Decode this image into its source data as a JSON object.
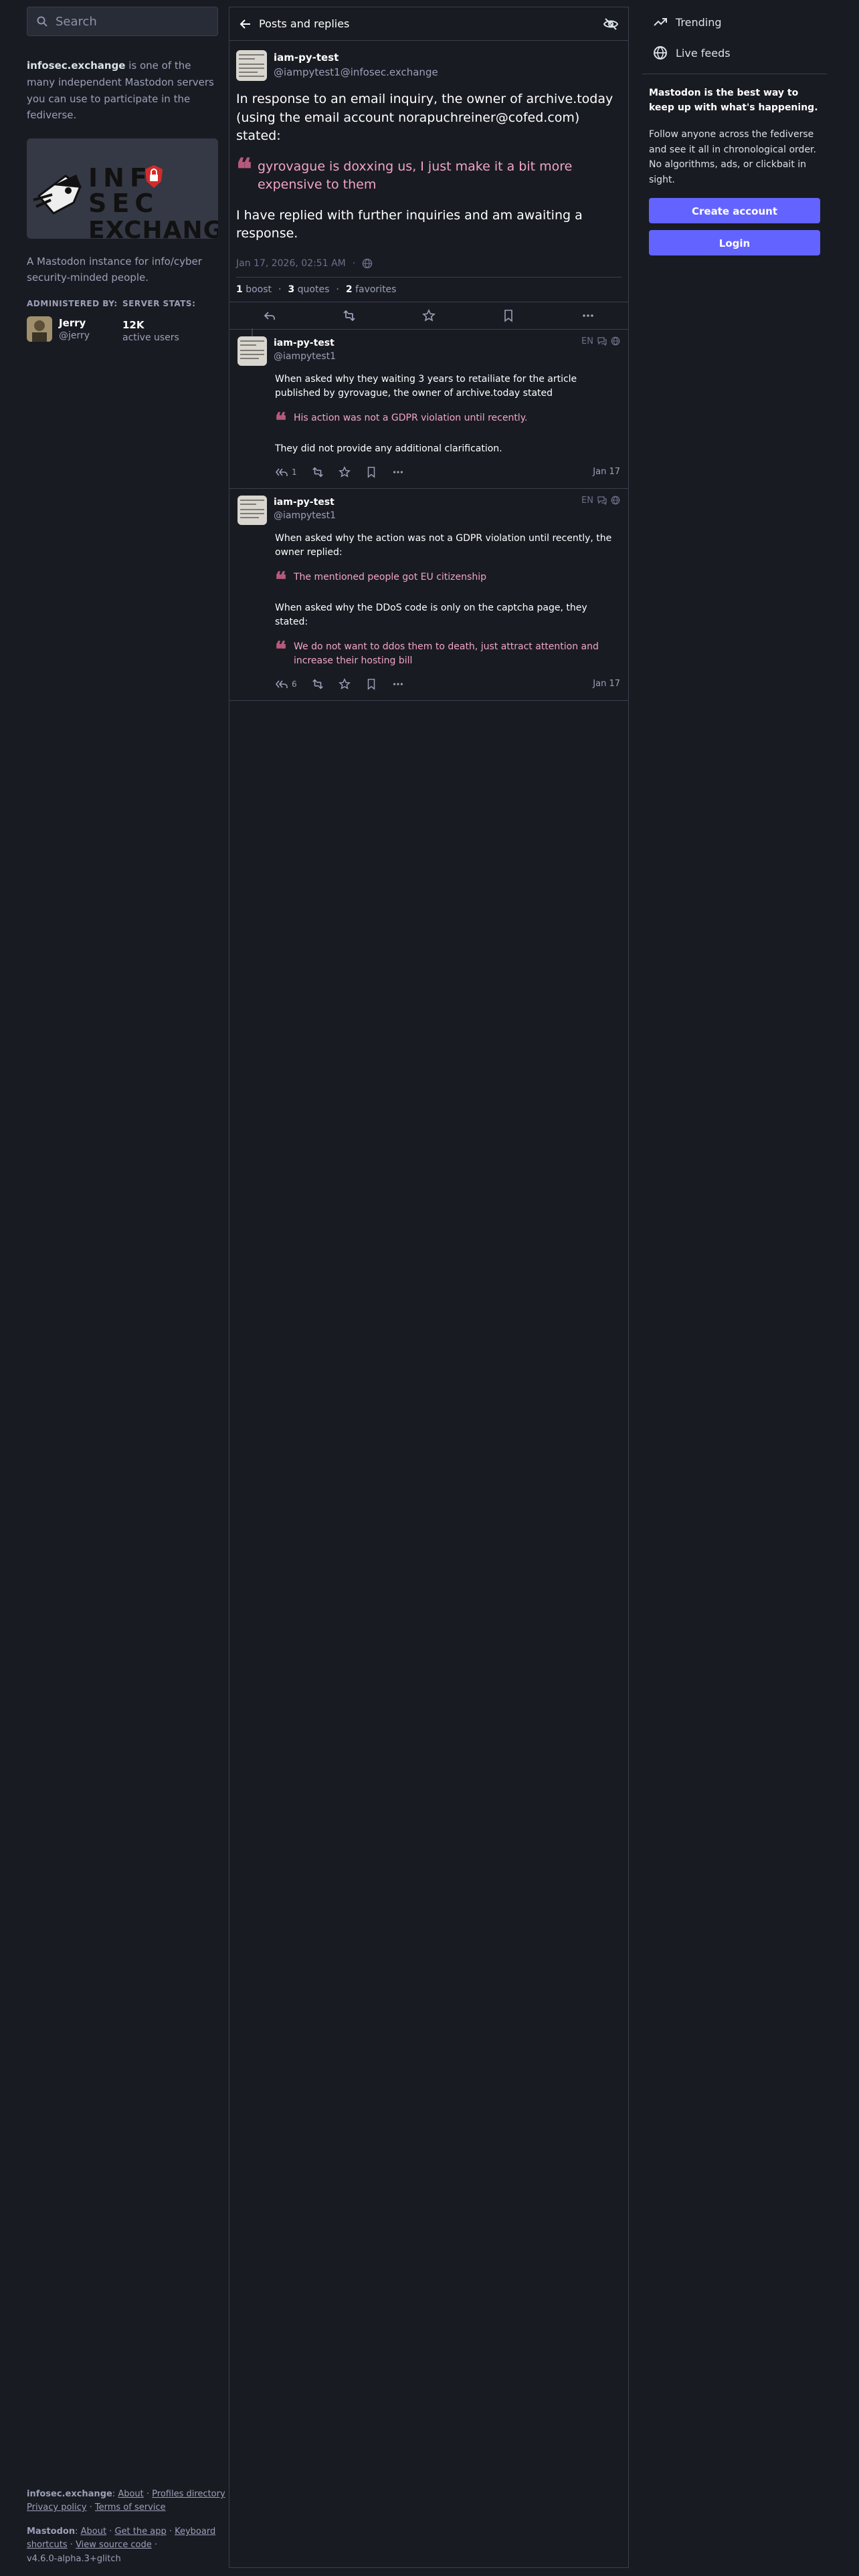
{
  "search": {
    "placeholder": "Search"
  },
  "server": {
    "domain": "infosec.exchange",
    "about_rest": " is one of the many independent Mastodon servers you can use to participate in the fediverse.",
    "logo_line1": "INF",
    "logo_line1b": "SEC",
    "logo_line2": "EXCHANGE",
    "description": "A Mastodon instance for info/cyber security-minded people.",
    "administered_label": "ADMINISTERED BY:",
    "admin_name": "Jerry",
    "admin_handle": "@jerry",
    "stats_label": "SERVER STATS:",
    "stats_value": "12K",
    "stats_caption": "active users"
  },
  "column": {
    "title": "Posts and replies"
  },
  "status": {
    "author_name": "iam-py-test",
    "author_handle": "@iampytest1@infosec.exchange",
    "body_intro": "In response to an email inquiry, the owner of archive.today (using the email account norapuchreiner@cofed.com) stated:",
    "quote": "gyrovague is doxxing us, I just make it a bit more expensive to them",
    "body_outro": "I have replied with further inquiries and am awaiting a response.",
    "timestamp": "Jan 17, 2026, 02:51 AM",
    "boosts_count": "1",
    "boosts_label": "boost",
    "quotes_count": "3",
    "quotes_label": "quotes",
    "favorites_count": "2",
    "favorites_label": "favorites"
  },
  "replies": [
    {
      "author_name": "iam-py-test",
      "author_handle": "@iampytest1",
      "lang": "EN",
      "text1": "When asked why they waiting 3 years to retailiate for the article published by gyrovague, the owner of archive.today stated",
      "quote1": "His action was not a GDPR violation until recently.",
      "text2": "They did not provide any additional clarification.",
      "reply_count": "1",
      "date": "Jan 17"
    },
    {
      "author_name": "iam-py-test",
      "author_handle": "@iampytest1",
      "lang": "EN",
      "text1": "When asked why the action was not a GDPR violation until recently, the owner replied:",
      "quote1": "The mentioned people got EU citizenship",
      "text2": "When asked why the DDoS code is only on the captcha page, they stated:",
      "quote2": "We do not want to ddos them to death, just attract attention and increase their hosting bill",
      "reply_count": "6",
      "date": "Jan 17"
    }
  ],
  "nav": {
    "trending": "Trending",
    "live_feeds": "Live feeds"
  },
  "promo": {
    "title": "Mastodon is the best way to keep up with what's happening.",
    "text": "Follow anyone across the fediverse and see it all in chronological order. No algorithms, ads, or clickbait in sight.",
    "create_account": "Create account",
    "login": "Login"
  },
  "footer": {
    "server_name": "infosec.exchange",
    "about": "About",
    "profiles_directory": "Profiles directory",
    "privacy_policy": "Privacy policy",
    "terms": "Terms of service",
    "mastodon": "Mastodon",
    "m_about": "About",
    "get_app": "Get the app",
    "keyboard_shortcuts": "Keyboard shortcuts",
    "view_source": "View source code",
    "version": "v4.6.0-alpha.3+glitch"
  },
  "colors": {
    "background": "#191b22",
    "border": "#393f4f",
    "accent": "#6364ff",
    "quote_text": "#f0a5c6",
    "quote_mark": "#b65a7c",
    "muted": "#9ba0b8"
  }
}
